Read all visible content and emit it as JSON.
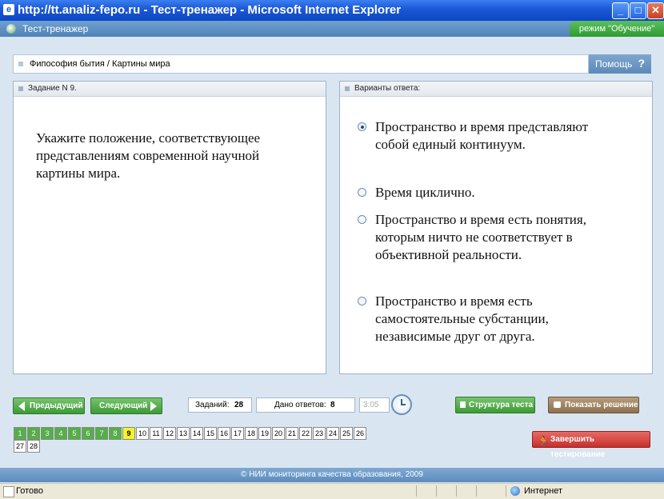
{
  "window": {
    "title": "http://tt.analiz-fepo.ru - Тест-тренажер - Microsoft Internet Explorer",
    "min": "_",
    "max": "□",
    "close": "✕"
  },
  "app": {
    "title": "Тест-тренажер",
    "mode": "режим \"Обучение\""
  },
  "breadcrumb": "Фипософия бытия / Картины мира",
  "help": {
    "label": "Помощь",
    "icon": "?"
  },
  "question": {
    "header": "Задание N 9.",
    "text": "Укажите положение, соответствующее представлениям современной научной картины мира."
  },
  "answers": {
    "header": "Варианты ответа:",
    "options": [
      {
        "text": "Пространство и время представляют собой единый континуум.",
        "selected": true
      },
      {
        "text": "Время циклично.",
        "selected": false
      },
      {
        "text": "Пространство и время есть понятия, которым ничто не соответствует в объективной реальности.",
        "selected": false
      },
      {
        "text": "Пространство и время есть самостоятельные субстанции, независимые друг от друга.",
        "selected": false
      }
    ]
  },
  "nav": {
    "prev": "Предыдущий",
    "next": "Следующий",
    "tasks_label": "Заданий:",
    "tasks_value": "28",
    "answered_label": "Дано ответов:",
    "answered_value": "8",
    "timer": "3:05",
    "structure": "Структура теста",
    "solution": "Показать решение",
    "finish": "Завершить тестирование"
  },
  "questions": {
    "total": 28,
    "current": 9,
    "answered": [
      1,
      2,
      3,
      4,
      5,
      6,
      7,
      8
    ]
  },
  "footer": "© НИИ мониторинга качества образования, 2009",
  "status": {
    "text": "Готово",
    "zone": "Интернет"
  }
}
